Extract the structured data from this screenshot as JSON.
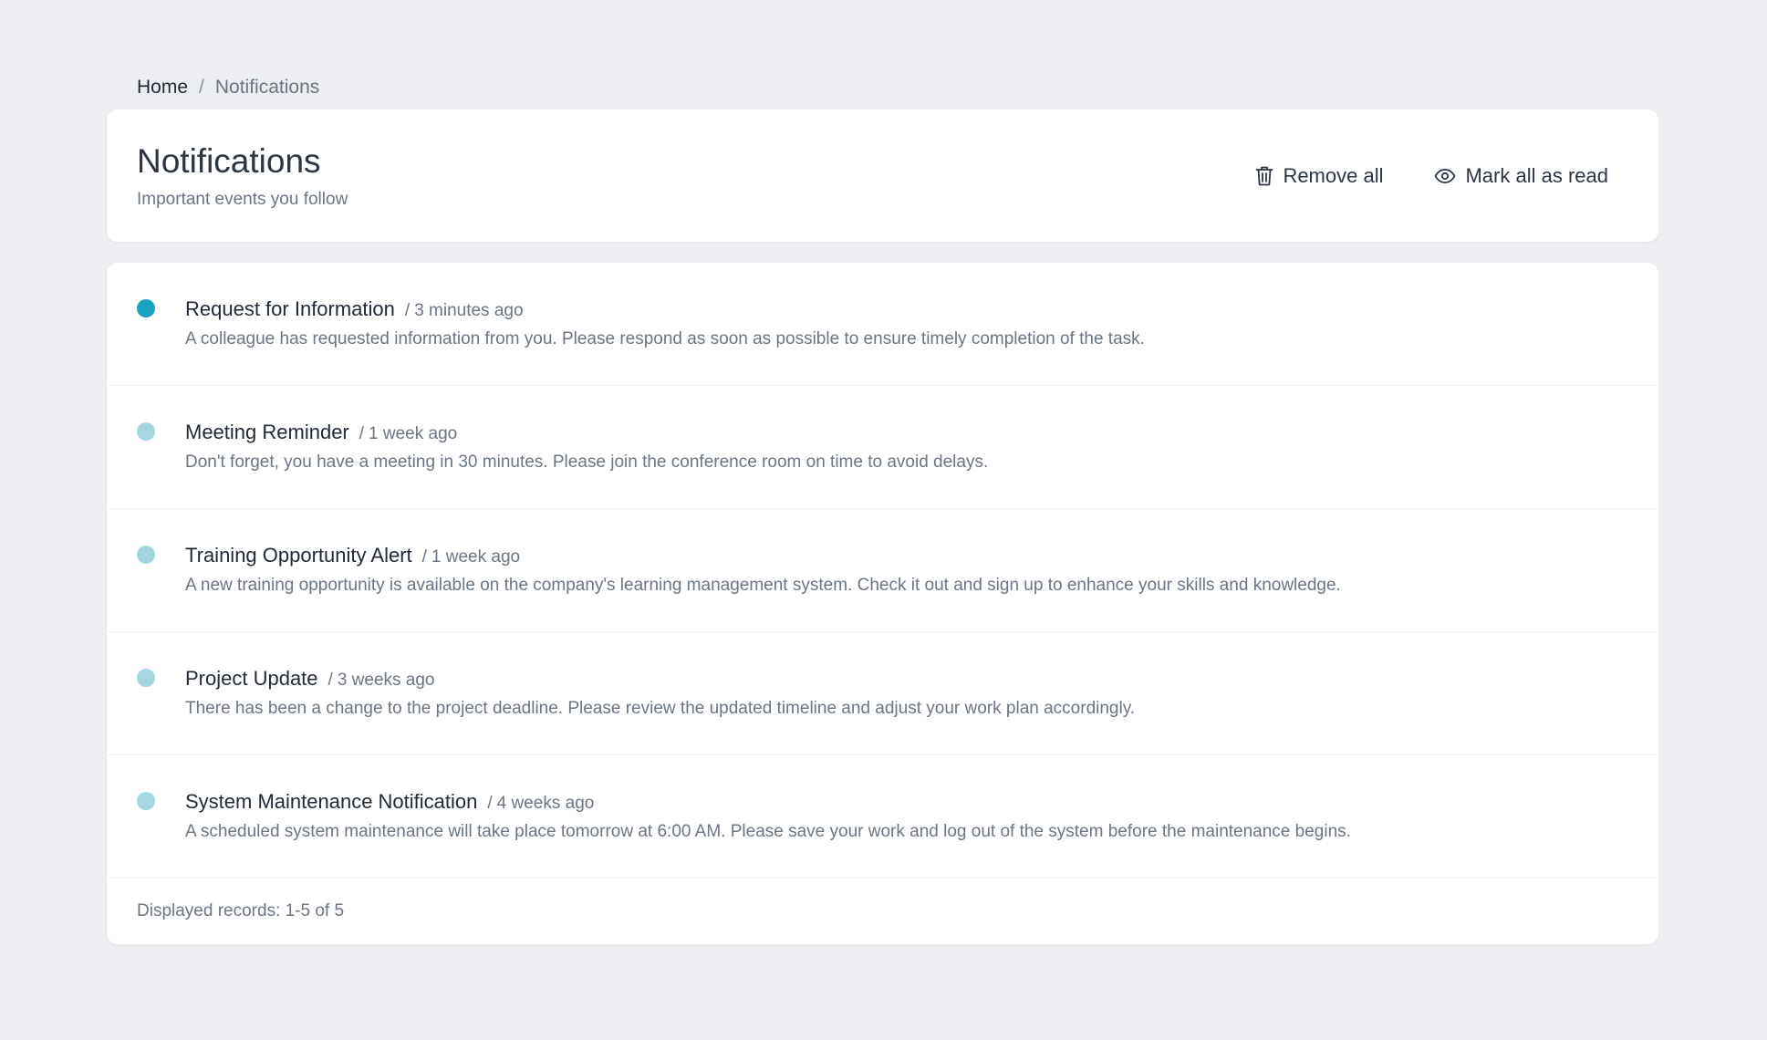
{
  "breadcrumb": {
    "home": "Home",
    "separator": "/",
    "current": "Notifications"
  },
  "header": {
    "title": "Notifications",
    "subtitle": "Important events you follow",
    "remove_all_label": "Remove all",
    "remove_all_icon": "trash-icon",
    "mark_all_read_label": "Mark all as read",
    "mark_all_read_icon": "eye-icon"
  },
  "notifications": [
    {
      "title": "Request for Information",
      "time": "3 minutes ago",
      "body": "A colleague has requested information from you. Please respond as soon as possible to ensure timely completion of the task.",
      "unread": true
    },
    {
      "title": "Meeting Reminder",
      "time": "1 week ago",
      "body": "Don't forget, you have a meeting in 30 minutes. Please join the conference room on time to avoid delays.",
      "unread": false
    },
    {
      "title": "Training Opportunity Alert",
      "time": "1 week ago",
      "body": "A new training opportunity is available on the company's learning management system. Check it out and sign up to enhance your skills and knowledge.",
      "unread": false
    },
    {
      "title": "Project Update",
      "time": "3 weeks ago",
      "body": "There has been a change to the project deadline. Please review the updated timeline and adjust your work plan accordingly.",
      "unread": false
    },
    {
      "title": "System Maintenance Notification",
      "time": "4 weeks ago",
      "body": "A scheduled system maintenance will take place tomorrow at 6:00 AM. Please save your work and log out of the system before the maintenance begins.",
      "unread": false
    }
  ],
  "footer": {
    "records_text": "Displayed records: 1-5 of 5"
  },
  "colors": {
    "background": "#eceef1",
    "unread_dot": "#1ba3c1",
    "read_dot": "#a3d8e3",
    "text_primary": "#2b3642",
    "text_muted": "#6b7682"
  }
}
